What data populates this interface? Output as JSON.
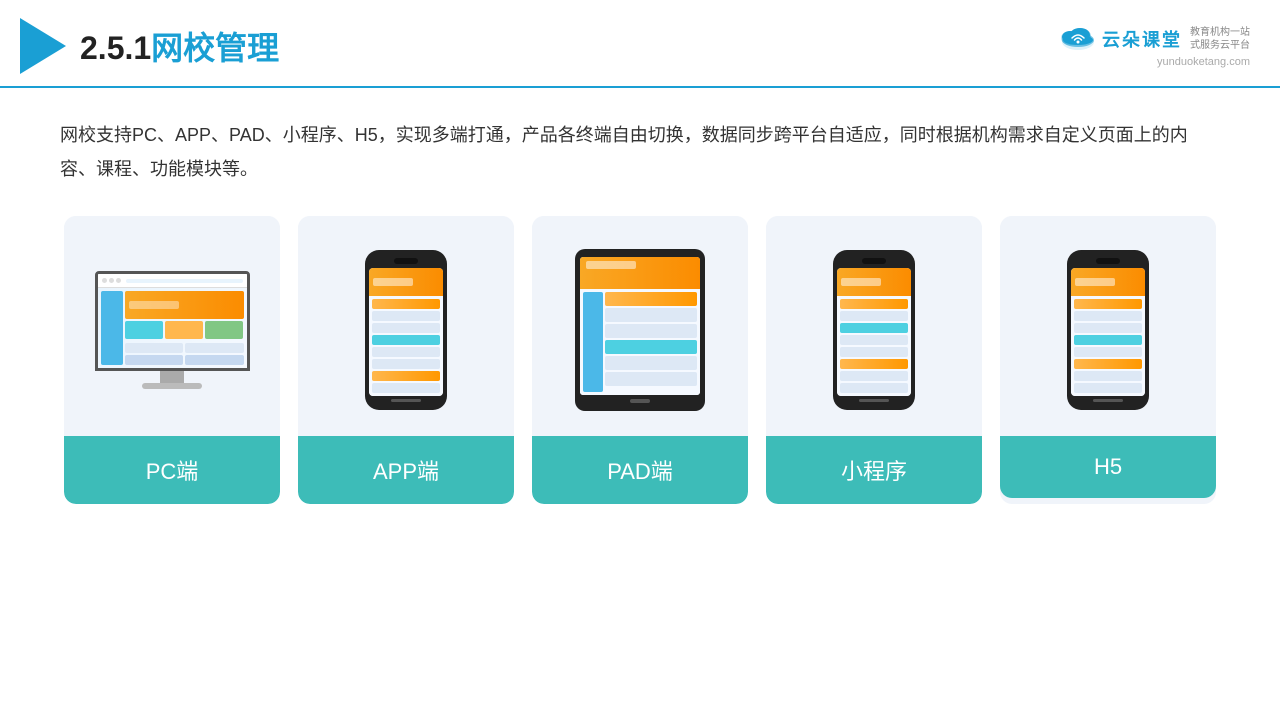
{
  "header": {
    "section_number": "2.5.1",
    "title_plain": "网校管理",
    "logo_cn": "云朵课堂",
    "logo_url": "yunduoketang.com",
    "logo_tagline": "教育机构一站\n式服务云平台"
  },
  "description": "网校支持PC、APP、PAD、小程序、H5，实现多端打通，产品各终端自由切换，数据同步跨平台自适应，同时根据机构需求自定义页面上的内容、课程、功能模块等。",
  "cards": [
    {
      "id": "pc",
      "label": "PC端"
    },
    {
      "id": "app",
      "label": "APP端"
    },
    {
      "id": "pad",
      "label": "PAD端"
    },
    {
      "id": "miniapp",
      "label": "小程序"
    },
    {
      "id": "h5",
      "label": "H5"
    }
  ],
  "colors": {
    "accent": "#1a9fd4",
    "teal": "#3dbcb8",
    "card_bg": "#f0f4fa"
  }
}
